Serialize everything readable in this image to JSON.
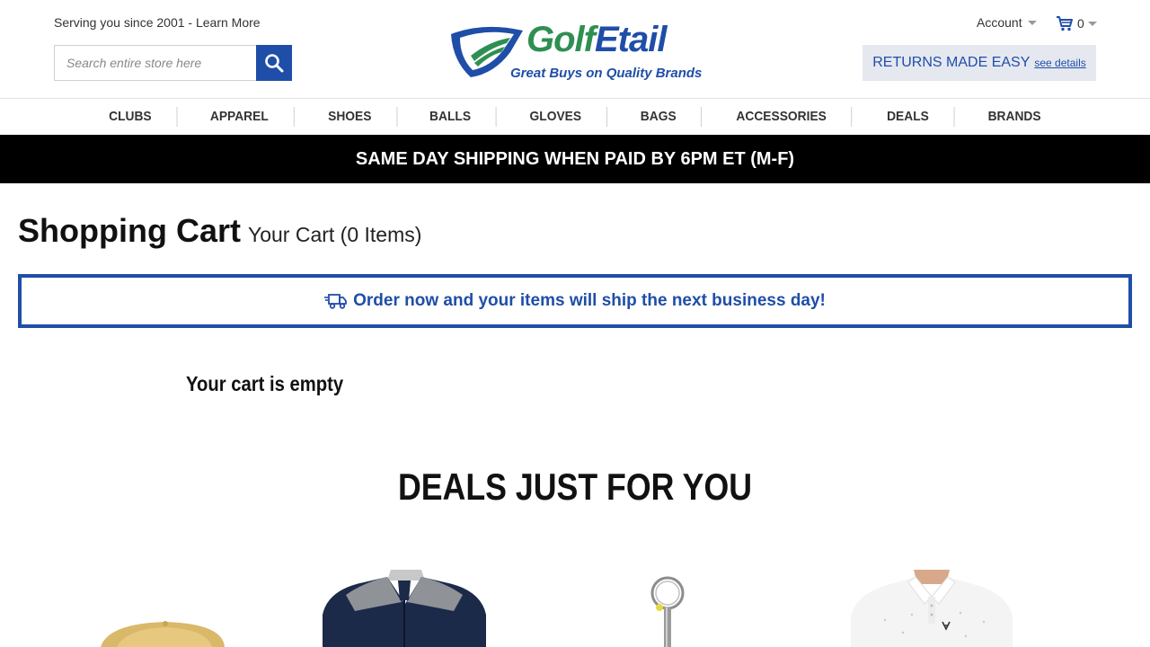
{
  "header": {
    "tagline": "Serving you since 2001 - Learn More",
    "search_placeholder": "Search entire store here",
    "account_label": "Account",
    "cart_count": "0",
    "returns_label": "RETURNS MADE EASY",
    "returns_link": "see details"
  },
  "logo": {
    "word_main": "Golf",
    "word_accent": "Etail",
    "subtitle": "Great Buys on Quality Brands"
  },
  "nav": {
    "items": [
      "CLUBS",
      "APPAREL",
      "SHOES",
      "BALLS",
      "GLOVES",
      "BAGS",
      "ACCESSORIES",
      "DEALS",
      "BRANDS"
    ]
  },
  "shipping_banner": "SAME DAY SHIPPING WHEN PAID BY 6PM ET (M-F)",
  "cart": {
    "title": "Shopping Cart",
    "count_text": "Your Cart (0 Items)",
    "notice": "Order now and your items will ship the next business day!",
    "empty_message": "Your cart is empty"
  },
  "deals": {
    "title": "DEALS JUST FOR YOU",
    "products": [
      {
        "icon": "cap-image"
      },
      {
        "icon": "jacket-image"
      },
      {
        "icon": "ball-retriever-image"
      },
      {
        "icon": "polo-shirt-image"
      }
    ]
  },
  "colors": {
    "brand_blue": "#1f4ea8",
    "brand_green": "#2f8f52",
    "banner_bg": "#000000",
    "returns_bg": "#e5e8ef"
  }
}
